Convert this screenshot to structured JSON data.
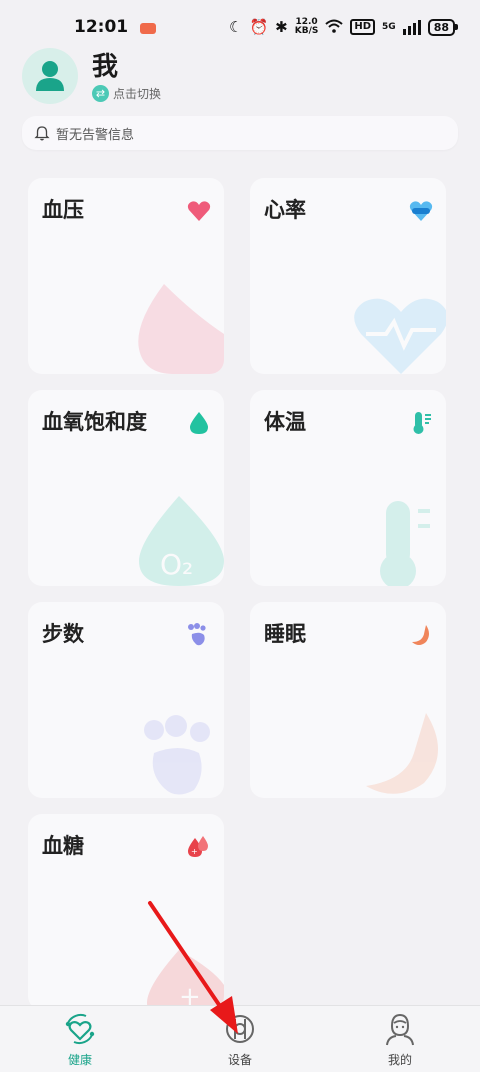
{
  "status_bar": {
    "time": "12:01",
    "speed_value": "12.0",
    "speed_unit": "KB/S",
    "hd": "HD",
    "network": "5G",
    "battery": "88"
  },
  "profile": {
    "name": "我",
    "switch_label": "点击切换"
  },
  "alert": {
    "text": "暂无告警信息"
  },
  "cards": [
    {
      "title": "血压",
      "icon": "heart-icon",
      "color": "#ef5b7a"
    },
    {
      "title": "心率",
      "icon": "heart-rate-icon",
      "color": "#2a9de0"
    },
    {
      "title": "血氧饱和度",
      "icon": "drop-icon",
      "color": "#22c2a0"
    },
    {
      "title": "体温",
      "icon": "thermometer-icon",
      "color": "#2fbfa8"
    },
    {
      "title": "步数",
      "icon": "footprint-icon",
      "color": "#8c8fe8"
    },
    {
      "title": "睡眠",
      "icon": "moon-icon",
      "color": "#f0855a"
    },
    {
      "title": "血糖",
      "icon": "blood-glucose-icon",
      "color": "#e8434b"
    }
  ],
  "tabs": [
    {
      "label": "健康",
      "icon": "health-icon",
      "active": true
    },
    {
      "label": "设备",
      "icon": "device-icon",
      "active": false
    },
    {
      "label": "我的",
      "icon": "profile-icon",
      "active": false
    }
  ],
  "colors": {
    "accent": "#1aa48a",
    "background": "#f2f1f4",
    "annotation_arrow": "#e8191a"
  }
}
